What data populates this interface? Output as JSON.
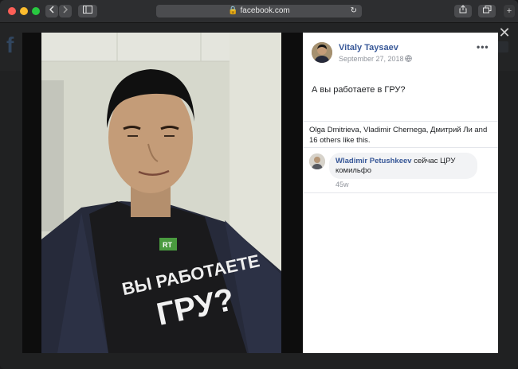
{
  "browser": {
    "url": "facebook.com",
    "back_icon": "chevron-left-icon",
    "forward_icon": "chevron-right-icon",
    "sidebar_icon": "sidebar-icon",
    "reload_icon": "reload-icon",
    "share_icon": "share-icon",
    "tabs_icon": "tabs-icon",
    "newtab_label": "+"
  },
  "photo": {
    "shirt_line1": "ВЫ РАБОТАЕТЕ",
    "shirt_line2": "ГРУ?"
  },
  "post": {
    "author": "Vitaly Taysaev",
    "date": "September 27, 2018 ·",
    "privacy_icon": "globe-icon",
    "more_label": "•••",
    "text": "А вы работаете в ГРУ?",
    "likes": "Olga Dmitrieva, Vladimir Chernega, Дмитрий Ли and 16 others like this."
  },
  "comment": {
    "author": "Wladimir Petushkeev",
    "text": "сейчас ЦРУ комильфо",
    "time": "45w"
  },
  "viewer": {
    "close_label": "✕"
  },
  "colors": {
    "link_blue": "#385898",
    "brand_green": "#4a9b3f",
    "shirt": "#1a1a1c",
    "jacket": "#262a3a"
  }
}
